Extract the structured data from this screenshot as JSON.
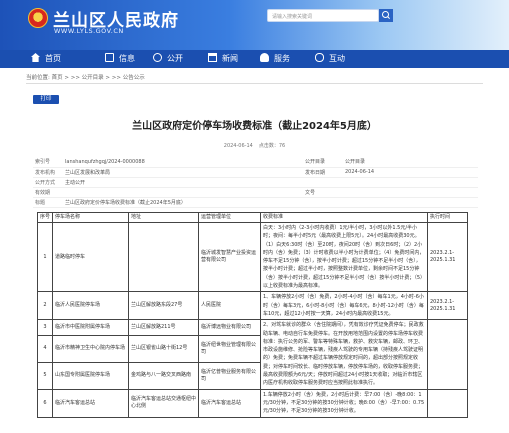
{
  "header": {
    "site_title": "兰山区人民政府",
    "site_url": "WWW.LYLS.GOV.CN",
    "search_placeholder": "请输入搜索关键词"
  },
  "nav": [
    {
      "label": "首页",
      "icon": "home-icon"
    },
    {
      "label": "信息",
      "icon": "info-icon"
    },
    {
      "label": "公开",
      "icon": "open-icon"
    },
    {
      "label": "新闻",
      "icon": "news-icon"
    },
    {
      "label": "服务",
      "icon": "service-icon"
    },
    {
      "label": "互动",
      "icon": "interact-icon"
    }
  ],
  "breadcrumb": "当前位置: 首页 > >> 公开目录 > >> 公告公示",
  "print_label": "打印",
  "title": "兰山区政府定价停车场收费标准（截止2024年5月底）",
  "meta_line": {
    "date": "2024-06-14",
    "views_label": "点击数：",
    "views": "76"
  },
  "meta": [
    {
      "k1": "索引号",
      "v1": "lanshanqufzhgqj/2024-0000088",
      "k2": "公开目录",
      "v2": "公开目录"
    },
    {
      "k1": "发布机构",
      "v1": "兰山区发展和改革局",
      "k2": "发布日期",
      "v2": "2024-06-14"
    },
    {
      "k1": "公开方式",
      "v1": "主动公开",
      "k2": "",
      "v2": ""
    },
    {
      "k1": "有效期",
      "v1": "",
      "k2": "文号",
      "v2": ""
    },
    {
      "k1": "标题",
      "v1": "兰山区政府定价停车场收费标准（截止2024年5月底）",
      "k2": "",
      "v2": ""
    }
  ],
  "table": {
    "headers": [
      "序号",
      "停车场名称",
      "地址",
      "运营管理单位",
      "收费标准",
      "执行时间"
    ],
    "rows": [
      {
        "no": "1",
        "name": "道路临时停车",
        "addr": "",
        "unit": "临沂城发智慧产业投资运营有限公司",
        "detail": "白天：3小时内（2-3小时内收费）1元/半小时，3小时以外1.5元/半小时；夜间：每半小时5元（最高收费上限5元）。24小时最高收费30元。（1）白天6:30时（含）至20时，夜间20时（含）到次日6时；（2）2小时内（含）免费；（3）计时收费以半小时为计费单位；（4）免费时间内，停车不足15分钟（含），按半小时计费；超过15分钟不足半小时（含），按半小时计费；超过半小时，按照整数计费单位，剩余时间不足15分钟（含）按半小时计费，超过15分钟不足半小时（含）按半小时计费；（5）以上收费标准为最高标准。",
        "time": "2023.2.1-2025.1.31"
      },
      {
        "no": "2",
        "name": "临沂人民医院停车场",
        "addr": "兰山区解放路东段27号",
        "unit": "人民医院",
        "detail": "1、车辆停放2小时（含）免费，2小时-4小时（含）每车1元，4小时-6小时（含）每车3元，6小时-8小时（含）每车6元，8小时-12小时（含）每车10元，超过12小时按一天算，24小时内最高收费15元。",
        "time": "2023.2.1-2025.1.31"
      },
      {
        "no": "3",
        "name": "临沂市中医院附属停车场",
        "addr": "兰山区解放路211号",
        "unit": "临沂博远物业有限公司",
        "detail": "",
        "time": ""
      },
      {
        "no": "4",
        "name": "临沂市精神卫生中心院内停车场",
        "addr": "兰山区银雀山路十街12号",
        "unit": "临沂纽世物业管理有限公司",
        "detail": "2、对驾车就诊的群众（含住院期间），凭有效诊疗凭证免费停车；民政救助车辆、电动自行车免费停车。在开放用地范围内设置的停车场停车收费标准：执行公务的军、警车等特殊车辆，救护、救灾车辆，邮政、环卫、市政设施维修、抢险等车辆，残疾人驾驶的专用车辆（持残疾人驾驶证明的）免费；免费车辆不超过车辆停放规定时间的，超出部分按照规定收费；对停车时间较长、临时停放车辆，停放停车场的，收取停车服务费；最高收费限额为6元/天；停放时间超过24小时按1天收取；对临沂市辖区内医疗机构收取停车服务费时应当按照此标准执行。",
        "time": ""
      },
      {
        "no": "5",
        "name": "山东国专附属医院停车场",
        "addr": "金鸡路与八一路交叉西路南",
        "unit": "临沂亿普物业服务有限公司",
        "detail": "",
        "time": ""
      },
      {
        "no": "6",
        "name": "临沂汽车客运总站",
        "addr": "临沂汽车客运总站交通枢纽中心北侧",
        "unit": "临沂汽车客运总站",
        "detail": "1.车辆停放2小时（含）免费，2小时后计费：早7:00（含）-晚8:00：1元/30分钟，不足30分钟的按30分钟计收；晚8:00（含）-早7:00：0.75元/30分钟，不足30分钟的按30分钟计收。",
        "time": ""
      }
    ]
  },
  "colors": {
    "brand_blue": "#1b4fb0",
    "header_gradient_end": "#e3f0fb"
  }
}
